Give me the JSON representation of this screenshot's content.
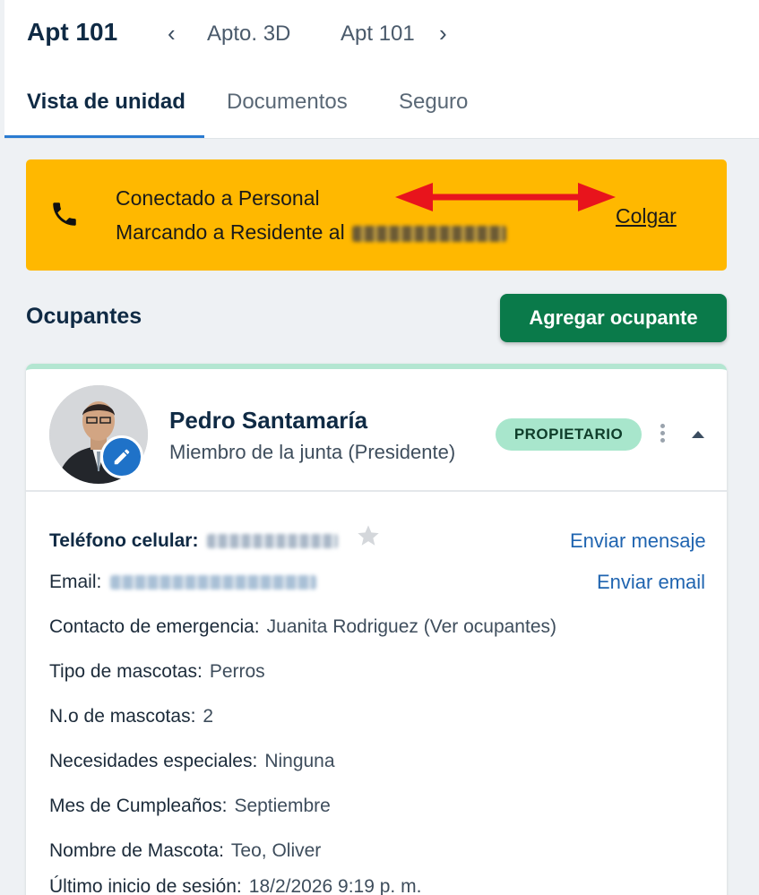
{
  "header": {
    "unit_title": "Apt 101",
    "prev_unit": "Apto. 3D",
    "next_unit": "Apt 101",
    "prev_icon": "chevron-left-icon",
    "next_icon": "chevron-right-icon"
  },
  "tabs": [
    {
      "label": "Vista de unidad",
      "active": true
    },
    {
      "label": "Documentos",
      "active": false
    },
    {
      "label": "Seguro",
      "active": false
    }
  ],
  "call_banner": {
    "icon": "phone-icon",
    "line1": "Conectado a Personal",
    "line2_prefix": "Marcando a Residente al",
    "hangup_label": "Colgar",
    "background": "#ffb800",
    "annotation_arrow_color": "#e8141c"
  },
  "occupants": {
    "heading": "Ocupantes",
    "add_button_label": "Agregar ocupante",
    "add_button_color": "#0a7a4a"
  },
  "occupant_card": {
    "name": "Pedro Santamaría",
    "role": "Miembro de la junta (Presidente)",
    "badge": "PROPIETARIO",
    "badge_color": "#a8e6cc",
    "edit_icon": "pencil-icon",
    "menu_icon": "kebab-menu-icon",
    "collapse_icon": "caret-up-icon",
    "mobile_label": "Teléfono celular:",
    "send_message_label": "Enviar mensaje",
    "email_label": "Email:",
    "send_email_label": "Enviar email",
    "fields": [
      {
        "label": "Contacto de emergencia:",
        "value": "Juanita Rodriguez (Ver ocupantes)"
      },
      {
        "label": "Tipo de mascotas:",
        "value": "Perros"
      },
      {
        "label": "N.o de mascotas:",
        "value": "2"
      },
      {
        "label": "Necesidades especiales:",
        "value": "Ninguna"
      },
      {
        "label": "Mes de Cumpleaños:",
        "value": "Septiembre"
      },
      {
        "label": "Nombre de Mascota:",
        "value": "Teo, Oliver"
      },
      {
        "label": "Último inicio de sesión:",
        "value": "18/2/2026 9:19 p. m."
      }
    ]
  }
}
